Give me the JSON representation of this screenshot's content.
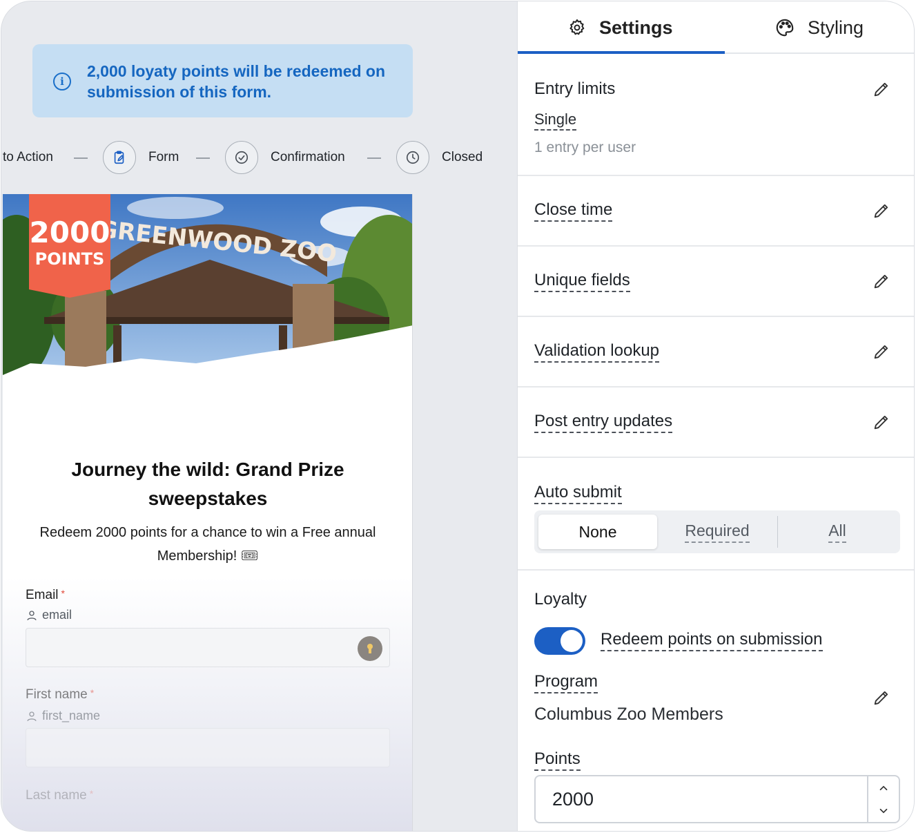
{
  "banner": {
    "text": "2,000 loyaty points will be redeemed on submission of this form."
  },
  "steps": [
    {
      "label": "to Action"
    },
    {
      "label": "Form"
    },
    {
      "label": "Confirmation"
    },
    {
      "label": "Closed"
    }
  ],
  "hero": {
    "badge_number": "2000",
    "badge_text": "POINTS",
    "sign_text": "GREENWOOD ZOO"
  },
  "form": {
    "title": "Journey the wild: Grand Prize sweepstakes",
    "subtitle": "Redeem 2000 points for a chance to win a Free annual Membership! 🎟",
    "fields": [
      {
        "label": "Email",
        "required_mark": "*",
        "hint": "email"
      },
      {
        "label": "First name",
        "required_mark": "*",
        "hint": "first_name"
      },
      {
        "label": "Last name",
        "required_mark": "*"
      }
    ]
  },
  "tabs": [
    {
      "label": "Settings",
      "icon": "gear-icon",
      "active": true
    },
    {
      "label": "Styling",
      "icon": "palette-icon",
      "active": false
    }
  ],
  "settings": {
    "entry_limits": {
      "title": "Entry limits",
      "value": "Single",
      "description": "1 entry per user"
    },
    "close_time": {
      "title": "Close time"
    },
    "unique_fields": {
      "title": "Unique fields"
    },
    "validation_lookup": {
      "title": "Validation lookup"
    },
    "post_entry_updates": {
      "title": "Post entry updates"
    },
    "auto_submit": {
      "title": "Auto submit",
      "options": [
        "None",
        "Required",
        "All"
      ],
      "selected": "None"
    },
    "loyalty": {
      "title": "Loyalty",
      "toggle_label": "Redeem points on submission",
      "toggle_on": true,
      "program_label": "Program",
      "program_value": "Columbus Zoo Members",
      "points_label": "Points",
      "points_value": "2000"
    }
  },
  "colors": {
    "accent": "#1c5fc4",
    "banner_bg": "#c5def3",
    "banner_text": "#1566c0",
    "badge": "#f0634a"
  }
}
